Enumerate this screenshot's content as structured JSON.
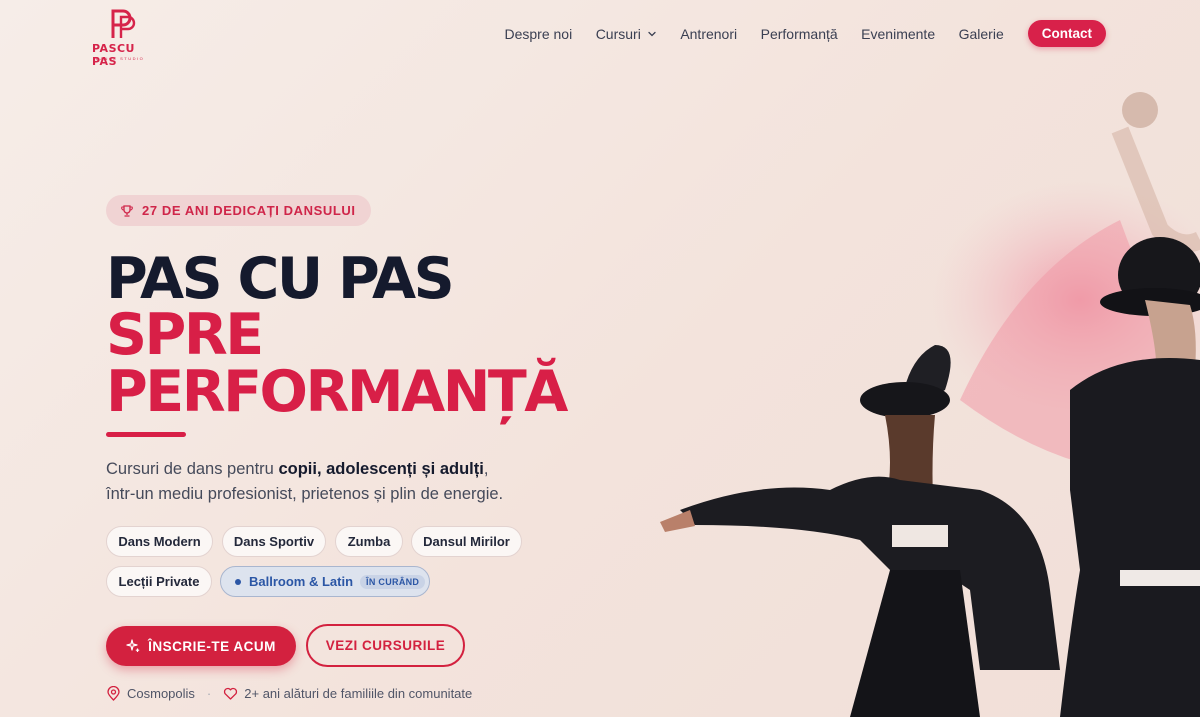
{
  "logo": {
    "wordmark": "PASCU PAS",
    "subtitle": "DANCE STUDIO"
  },
  "nav": {
    "items": [
      {
        "label": "Despre noi"
      },
      {
        "label": "Cursuri"
      },
      {
        "label": "Antrenori"
      },
      {
        "label": "Performanță"
      },
      {
        "label": "Evenimente"
      },
      {
        "label": "Galerie"
      }
    ],
    "contact_label": "Contact"
  },
  "hero": {
    "badge": "27 DE ANI DEDICAȚI DANSULUI",
    "title_line1": "PAS CU PAS",
    "title_line2": "SPRE",
    "title_line3": "PERFORMANȚĂ",
    "lead_prefix": "Cursuri de dans pentru ",
    "lead_bold": "copii, adolescenți și adulți",
    "lead_suffix": ",",
    "lead_line2": "într-un mediu profesionist, prietenos și plin de energie.",
    "chips": [
      {
        "label": "Dans Modern"
      },
      {
        "label": "Dans Sportiv"
      },
      {
        "label": "Zumba"
      },
      {
        "label": "Dansul Mirilor"
      },
      {
        "label": "Lecții Private"
      },
      {
        "label": "Ballroom & Latin",
        "tag": "ÎN CURÂND"
      }
    ],
    "primary_cta": "ÎNSCRIE-TE ACUM",
    "secondary_cta": "VEZI CURSURILE",
    "location": "Cosmopolis",
    "community": "2+ ani alături de familiile din comunitate"
  },
  "colors": {
    "accent": "#d81f47",
    "navy": "#151a2d",
    "soon_blue": "#2b56a5"
  },
  "icons": [
    "trophy-icon",
    "chevron-down-icon",
    "sparkle-icon",
    "location-pin-icon",
    "heart-icon"
  ]
}
